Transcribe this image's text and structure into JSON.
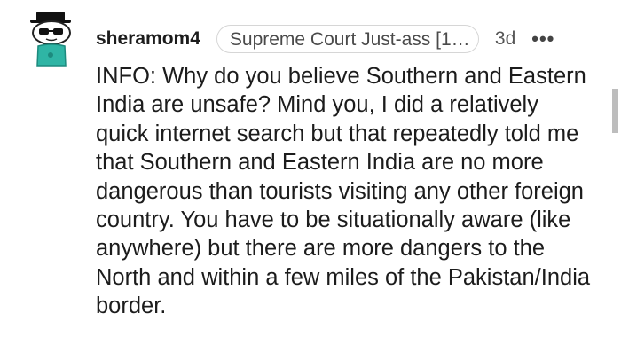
{
  "comment": {
    "username": "sheramom4",
    "flair": "Supreme Court Just-ass [1…",
    "age": "3d",
    "more_icon": "more-dots-icon",
    "more_label": "•••",
    "body": "INFO: Why do you believe Southern and Eastern India are unsafe? Mind you, I did a relatively quick internet search but that repeatedly told me that Southern and Eastern India are no more dangerous than tourists visiting any other foreign country. You have to be situationally aware (like anywhere) but there are more dangers to the North and within a few miles of the Pakistan/India border."
  },
  "colors": {
    "avatar_body": "#2fb5a5",
    "text": "#1c1c1c",
    "meta": "#555555"
  }
}
